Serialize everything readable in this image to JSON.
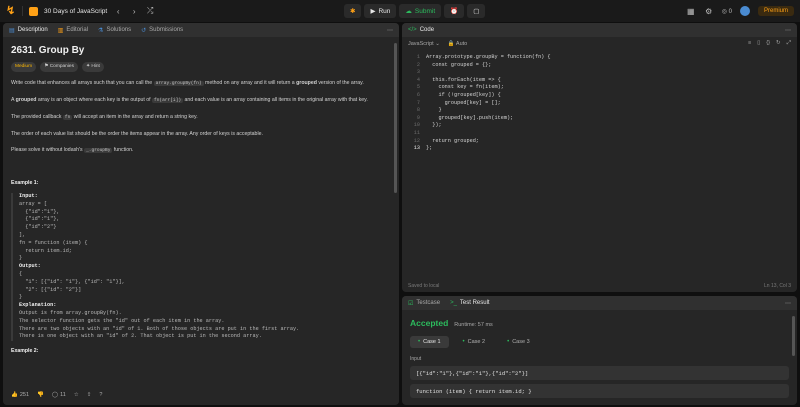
{
  "app": {
    "problem_list_title": "30 Days of JavaScript",
    "run_label": "Run",
    "submit_label": "Submit",
    "notifications": "0",
    "premium_label": "Premium"
  },
  "left_panel": {
    "tabs": [
      "Description",
      "Editorial",
      "Solutions",
      "Submissions"
    ],
    "title": "2631. Group By",
    "tags": [
      "Medium",
      "Companies",
      "Hint"
    ],
    "para1_a": "Write code that enhances all arrays such that you can call the ",
    "para1_code": "array.groupBy(fn)",
    "para1_b": " method on any array and it will return a ",
    "para1_bold": "grouped",
    "para1_c": " version of the array.",
    "para2_a": "A ",
    "para2_bold": "grouped",
    "para2_b": " array is an object where each key is the output of ",
    "para2_code": "fn(arr[i])",
    "para2_c": " and each value is an array containing all items in the original array with that key.",
    "para3_a": "The provided callback ",
    "para3_code": "fn",
    "para3_b": " will accept an item in the array and return a string key.",
    "para4": "The order of each value list should be the order the items appear in the array. Any order of keys is acceptable.",
    "para5_a": "Please solve it without lodash's ",
    "para5_code": "_.groupBy",
    "para5_b": " function.",
    "example1_title": "Example 1:",
    "example1_input_label": "Input:",
    "example1_input": "array = [\n  {\"id\":\"1\"},\n  {\"id\":\"1\"},\n  {\"id\":\"2\"}\n],\nfn = function (item) {\n  return item.id;\n}",
    "example1_output_label": "Output:",
    "example1_output": "{\n  \"1\": [{\"id\": \"1\"}, {\"id\": \"1\"}],\n  \"2\": [{\"id\": \"2\"}]\n}",
    "example1_expl_label": "Explanation:",
    "example1_expl": "Output is from array.groupBy(fn).\nThe selector function gets the \"id\" out of each item in the array.\nThere are two objects with an \"id\" of 1. Both of those objects are put in the first array.\nThere is one object with an \"id\" of 2. That object is put in the second array.",
    "example2_title": "Example 2:",
    "likes": "251",
    "comments": "11"
  },
  "code_panel": {
    "tab": "Code",
    "language": "JavaScript",
    "auto_label": "Auto",
    "line_numbers": [
      "1",
      "2",
      "3",
      "4",
      "5",
      "6",
      "7",
      "8",
      "9",
      "10",
      "11",
      "12",
      "13"
    ],
    "lines": [
      "Array.prototype.groupBy = function(fn) {",
      "  const grouped = {};",
      "",
      "  this.forEach(item => {",
      "    const key = fn(item);",
      "    if (!grouped[key]) {",
      "      grouped[key] = [];",
      "    }",
      "    grouped[key].push(item);",
      "  });",
      "",
      "  return grouped;",
      "};"
    ],
    "saved": "Saved to local",
    "cursor": "Ln 13, Col 3"
  },
  "test_panel": {
    "tabs": [
      "Testcase",
      "Test Result"
    ],
    "status": "Accepted",
    "runtime": "Runtime: 57 ms",
    "cases": [
      "Case 1",
      "Case 2",
      "Case 3"
    ],
    "input_label": "Input",
    "input_array": "[{\"id\":\"1\"},{\"id\":\"1\"},{\"id\":\"2\"}]",
    "input_fn": "function (item) { return item.id; }"
  }
}
